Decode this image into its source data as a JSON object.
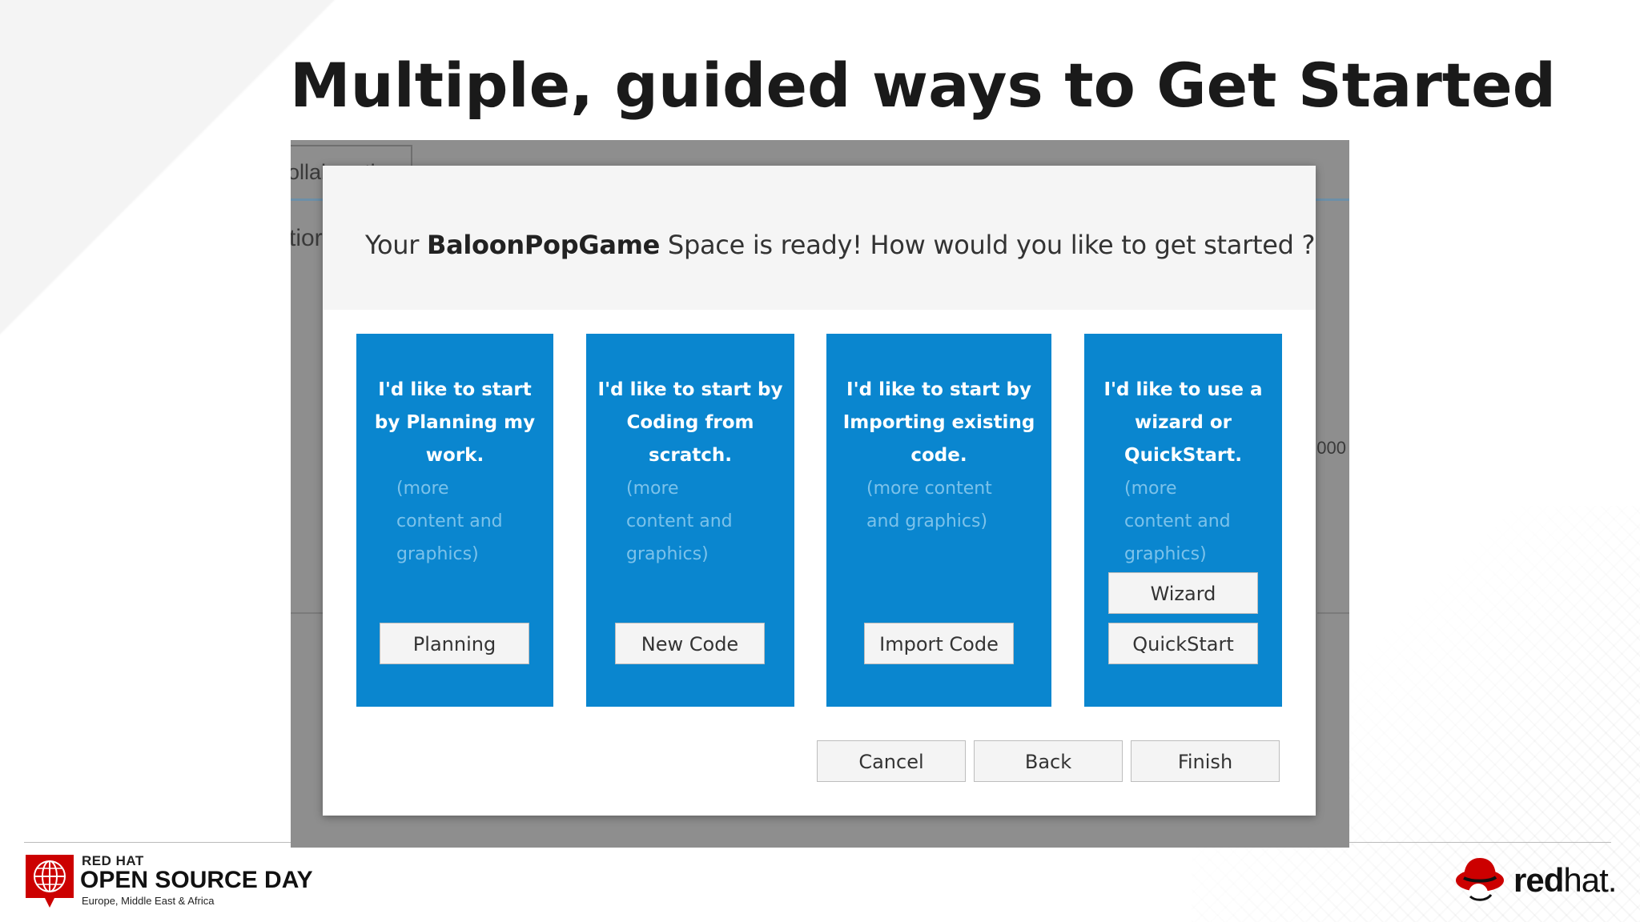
{
  "slide": {
    "title": "Multiple, guided ways to Get Started"
  },
  "background_app": {
    "tab_label_fragment": "ollaborating",
    "left_fragment": "tior",
    "right_fragment": "000"
  },
  "dialog": {
    "question_prefix": "Your ",
    "space_name": "BaloonPopGame",
    "question_suffix": " Space is ready! How would you like to get started ?",
    "cards": [
      {
        "title": "I'd like to start by Planning my work.",
        "more": "(more content and graphics)",
        "buttons": [
          "Planning"
        ]
      },
      {
        "title": "I'd like to start by Coding from scratch.",
        "more": "(more content and graphics)",
        "buttons": [
          "New Code"
        ]
      },
      {
        "title": "I'd like to start by Importing existing code.",
        "more": "(more content and graphics)",
        "buttons": [
          "Import Code"
        ]
      },
      {
        "title": "I'd like to use a wizard or QuickStart.",
        "more": "(more content and graphics)",
        "buttons": [
          "Wizard",
          "QuickStart"
        ]
      }
    ],
    "footer": {
      "cancel": "Cancel",
      "back": "Back",
      "finish": "Finish"
    },
    "card_color": "#0a86cf"
  },
  "branding": {
    "event_line1": "RED HAT",
    "event_line2": "OPEN SOURCE DAY",
    "event_line3": "Europe, Middle East & Africa",
    "company_bold": "red",
    "company_light": "hat.",
    "brand_red": "#cc0000"
  }
}
